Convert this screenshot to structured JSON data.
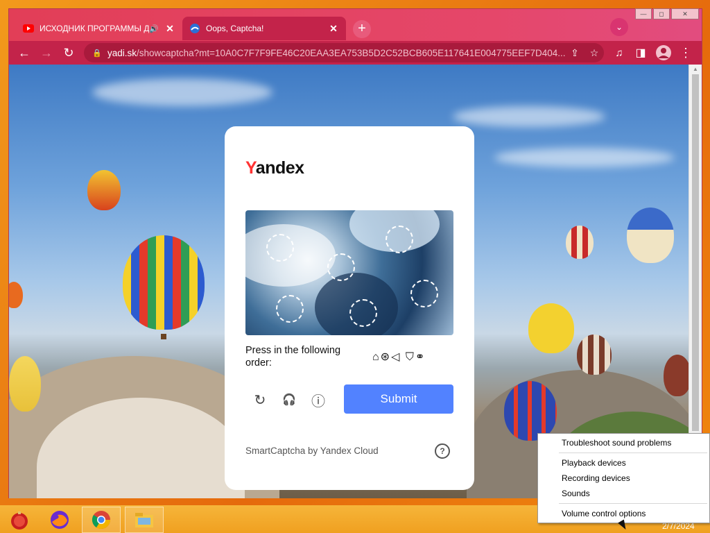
{
  "browser": {
    "tabs": [
      {
        "title": "ИСХОДНИК ПРОГРАММЫ Д",
        "favicon": "youtube-icon",
        "audio_icon": "speaker-icon",
        "active": false
      },
      {
        "title": "Oops, Captcha!",
        "favicon": "yandex-icon",
        "active": true
      }
    ],
    "address_bar": {
      "host": "yadi.sk",
      "path": "/showcaptcha?mt=10A0C7F7F9FE46C20EAA3EA753B5D2C52BCB605E117641E004775EEF7D404..."
    },
    "icons": {
      "back": "←",
      "forward": "→",
      "reload": "↻",
      "lock": "🔒",
      "share": "⇪",
      "star": "☆",
      "media": "♫",
      "sidepanel": "◨",
      "menu": "⋮",
      "new_tab": "+",
      "tab_search": "⌄",
      "tab_close": "✕",
      "minimize": "—",
      "maximize": "◻",
      "close": "✕"
    }
  },
  "captcha": {
    "logo_first": "Y",
    "logo_rest": "andex",
    "instruction": "Press in the following order:",
    "order_icons": "⌂⊛◁ ⛉⚭",
    "submit_label": "Submit",
    "refresh_icon": "↻",
    "audio_icon": "🎧",
    "info_icon": "ⓘ",
    "branding": "SmartCaptcha by Yandex Cloud",
    "help_label": "?"
  },
  "context_menu": {
    "items": [
      "Troubleshoot sound problems",
      "Playback devices",
      "Recording devices",
      "Sounds",
      "Volume control options"
    ]
  },
  "taskbar": {
    "clock": "2/7/2024"
  },
  "colors": {
    "tab_strip": "#e23e57",
    "toolbar": "#c3234a",
    "submit": "#5282ff",
    "logo_accent": "#ff3333",
    "taskbar": "#f0a020"
  }
}
